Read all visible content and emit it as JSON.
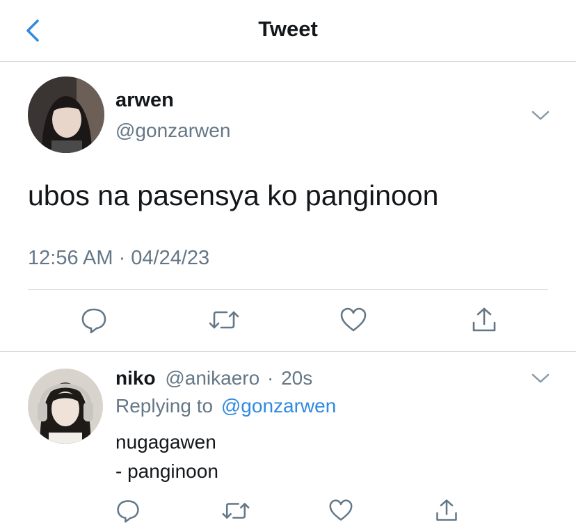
{
  "header": {
    "title": "Tweet"
  },
  "tweet": {
    "author_name": "arwen",
    "author_handle": "@gonzarwen",
    "text": "ubos na pasensya ko panginoon",
    "timestamp": "12:56 AM · 04/24/23"
  },
  "reply": {
    "author_name": "niko",
    "author_handle": "@anikaero",
    "separator": "·",
    "age": "20s",
    "replying_prefix": "Replying to",
    "replying_to": "@gonzarwen",
    "lines": [
      "nugagawen",
      "- panginoon"
    ]
  },
  "icons": {
    "back": "chevron-left-icon",
    "menu": "chevron-down-icon",
    "reply": "speech-bubble-icon",
    "retweet": "retweet-icon",
    "like": "heart-icon",
    "share": "share-icon"
  },
  "colors": {
    "accent": "#2f8ae0",
    "secondary_text": "#657786",
    "divider": "#d7d9db",
    "icon": "#657786"
  }
}
